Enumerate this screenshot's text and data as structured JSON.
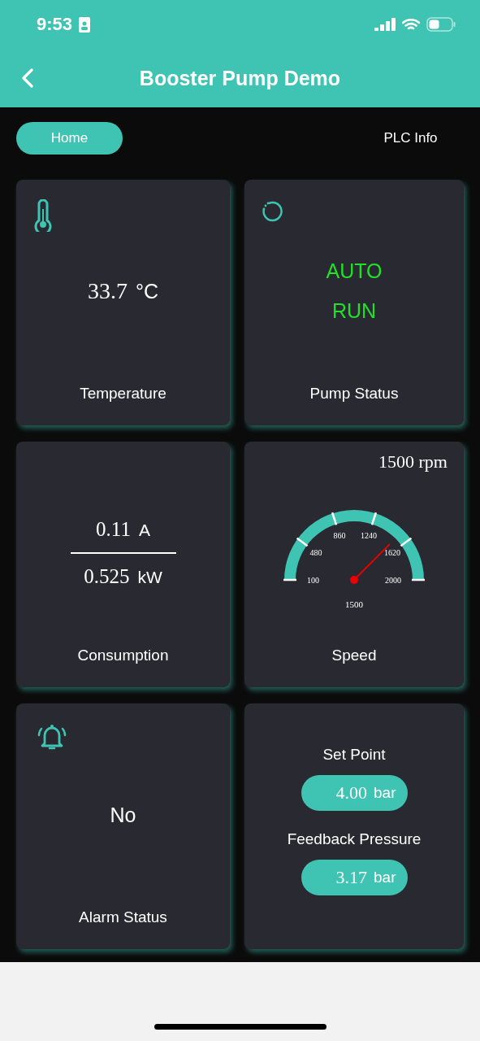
{
  "status_bar": {
    "time": "9:53"
  },
  "header": {
    "title": "Booster Pump Demo"
  },
  "tabs": [
    {
      "label": "Home",
      "selected": true
    },
    {
      "label": "PLC Info",
      "selected": false
    }
  ],
  "cards": [
    {
      "kind": "temperature",
      "value": "33.7",
      "unit": "°C",
      "label": "Temperature"
    },
    {
      "kind": "status",
      "lines": [
        "AUTO",
        "RUN"
      ],
      "color": "#22e02a",
      "label": "Pump Status"
    },
    {
      "kind": "consumption",
      "current": "0.11",
      "current_unit": "A",
      "power": "0.525",
      "power_unit": "kW",
      "label": "Consumption"
    },
    {
      "kind": "gauge",
      "value": "1500",
      "unit": "rpm",
      "ticks": [
        "100",
        "480",
        "860",
        "1240",
        "1620",
        "2000"
      ],
      "reading": "1500",
      "label": "Speed"
    },
    {
      "kind": "alarm",
      "value": "No",
      "label": "Alarm Status"
    },
    {
      "kind": "pressure",
      "items": [
        {
          "label": "Set Point",
          "value": "4.00",
          "unit": "bar"
        },
        {
          "label": "Feedback Pressure",
          "value": "3.17",
          "unit": "bar"
        }
      ]
    }
  ]
}
